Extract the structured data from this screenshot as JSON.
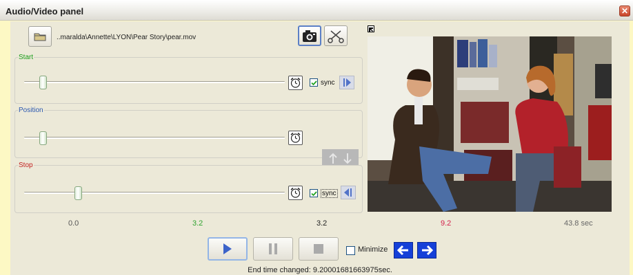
{
  "window": {
    "title": "Audio/Video panel",
    "close_glyph": "✕"
  },
  "file": {
    "path": "..maralda\\Annette\\LYON\\Pear Story\\pear.mov"
  },
  "start_group": {
    "label": "Start",
    "label_color": "#1a9c1a",
    "position_fraction": 0.068,
    "sync_label": "sync",
    "sync_checked": true
  },
  "position_group": {
    "label": "Position",
    "label_color": "#2a57b0",
    "position_fraction": 0.068
  },
  "stop_group": {
    "label": "Stop",
    "label_color": "#c22020",
    "position_fraction": 0.21,
    "sync_label": "sync",
    "sync_checked": true
  },
  "scale": [
    {
      "text": "0.0",
      "color": "#555555"
    },
    {
      "text": "3.2",
      "color": "#2fa32f"
    },
    {
      "text": "3.2",
      "color": "#222222"
    },
    {
      "text": "9.2",
      "color": "#d21f4a"
    },
    {
      "text": "43.8  sec",
      "color": "#666666"
    }
  ],
  "playback": {
    "minimize_label": "Minimize",
    "minimize_checked": false
  },
  "status": {
    "text": "End time changed: 9.20001681663975sec."
  },
  "icons": {
    "folder": "folder-icon",
    "camera": "camera-icon",
    "scissors": "scissors-icon",
    "clock": "alarm-clock-icon",
    "play": "play-icon",
    "pause": "pause-icon",
    "stop": "stop-icon",
    "back": "arrow-left-icon",
    "forward": "arrow-right-icon"
  }
}
